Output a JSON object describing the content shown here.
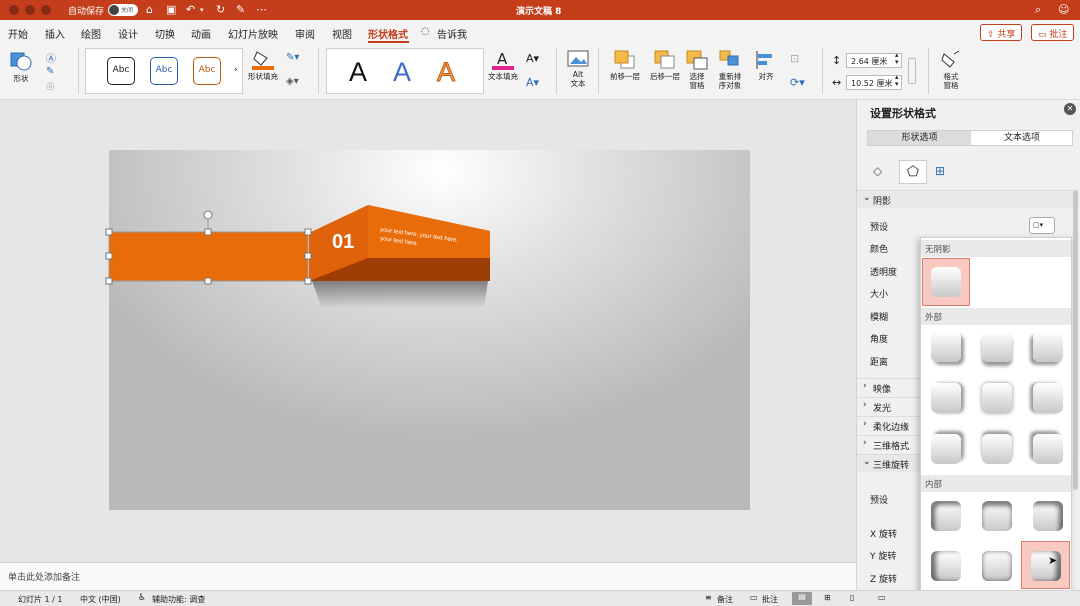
{
  "titlebar": {
    "title": "演示文稿 8",
    "autosave_label": "自动保存",
    "autosave_state": "关闭"
  },
  "menubar": {
    "tabs": [
      "开始",
      "插入",
      "绘图",
      "设计",
      "切换",
      "动画",
      "幻灯片放映",
      "审阅",
      "视图",
      "形状格式",
      "告诉我"
    ],
    "active_tab": "形状格式",
    "share_label": "共享",
    "comments_label": "批注"
  },
  "ribbon": {
    "shapes_label": "形状",
    "style_samples": [
      "Abc",
      "Abc",
      "Abc"
    ],
    "style_sample_colors": [
      "#222222",
      "#2f5fb0",
      "#c55a11"
    ],
    "shape_fill_label": "形状填充",
    "wordart_samples": [
      "A",
      "A",
      "A"
    ],
    "wordart_colors": [
      "#111111",
      "#3b6cc8",
      "#f1a35a"
    ],
    "text_fill_label": "文本填充",
    "alt_text_label": [
      "Alt",
      "文本"
    ],
    "bring_forward_label": "前移一层",
    "send_backward_label": "后移一层",
    "selection_pane_label": [
      "选择",
      "窗格"
    ],
    "reorder_label": [
      "重新排",
      "序对象"
    ],
    "align_label": "对齐",
    "height_value": "2.64 厘米",
    "width_value": "10.52 厘米",
    "format_pane_label": [
      "格式",
      "窗格"
    ]
  },
  "slide": {
    "number_badge": "01",
    "caption_line1": "your text here. your text here.",
    "caption_line2": "your text here.",
    "accent": "#e86c0a"
  },
  "notes": {
    "placeholder": "单击此处添加备注"
  },
  "statusbar": {
    "slide_info": "幻灯片 1 / 1",
    "language": "中文 (中国)",
    "accessibility": "辅助功能: 调查",
    "notes_label": "备注",
    "comments_label": "批注"
  },
  "panel": {
    "title": "设置形状格式",
    "tabs": [
      "形状选项",
      "文本选项"
    ],
    "shadow_section": "阴影",
    "shadow_props": [
      "预设",
      "颜色",
      "透明度",
      "大小",
      "模糊",
      "角度",
      "距离"
    ],
    "collapsed_sections": [
      "映像",
      "发光",
      "柔化边缘",
      "三维格式"
    ],
    "rotation_section": "三维旋转",
    "rotation_props": [
      "预设",
      "X 旋转",
      "Y 旋转",
      "Z 旋转"
    ]
  },
  "shadow_popup": {
    "no_shadow_label": "无阴影",
    "outer_label": "外部",
    "inner_label": "内部"
  }
}
